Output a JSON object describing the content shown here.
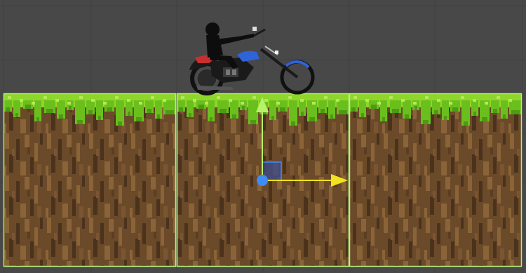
{
  "scene": {
    "colors": {
      "background": "#484848",
      "grid_line": "#3f3f3f",
      "grass_light": "#8ed62a",
      "grass_mid": "#6bbf1d",
      "grass_dark": "#4d9a15",
      "dirt_base": "#6b4a2a",
      "dirt_light": "#8a6438",
      "dirt_dark": "#4b321c",
      "tile_outline": "#b6f07a",
      "gizmo_y_axis": "#b8f26a",
      "gizmo_x_axis": "#f2e21f",
      "gizmo_center": "#3f8cf5",
      "gizmo_plane": "#3a4a8c",
      "bike_body": "#1a1a1a",
      "bike_tank": "#2f63d8",
      "bike_seat": "#c83030",
      "rider": "#0d0d0d"
    },
    "tiles": [
      {
        "name": "ground-tile-1"
      },
      {
        "name": "ground-tile-2"
      },
      {
        "name": "ground-tile-3"
      }
    ],
    "sprites": [
      "motorcycle-rider-sprite"
    ],
    "gizmo": {
      "type": "move-tool",
      "axes": [
        "x-axis-arrow",
        "y-axis-arrow"
      ],
      "plane_handle": "xy-plane-handle",
      "pivot": "pivot-handle"
    }
  }
}
